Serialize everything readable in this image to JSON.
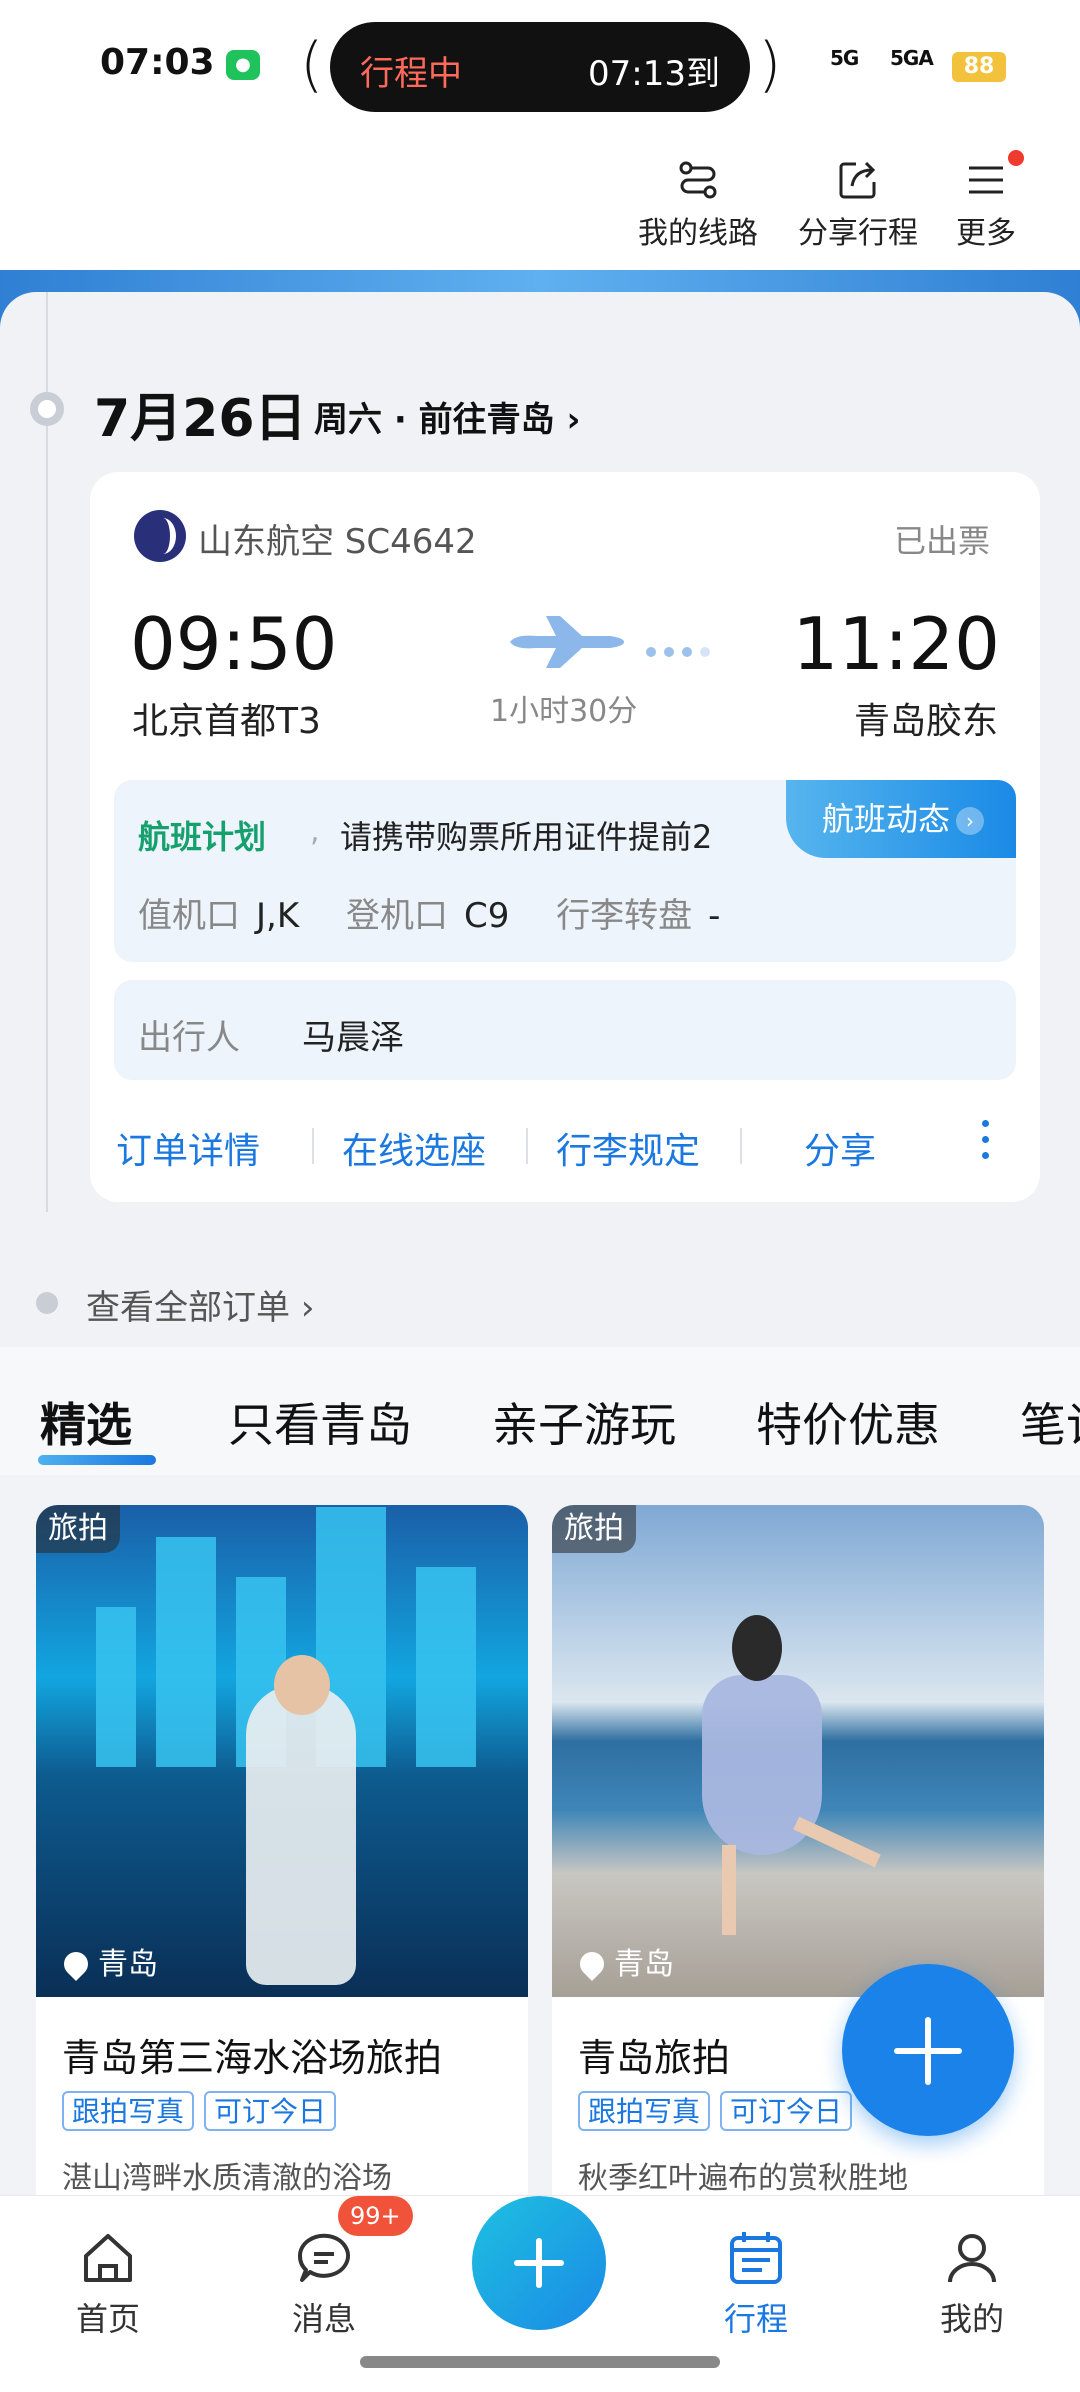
{
  "status_bar": {
    "time": "07:03",
    "island_status": "行程中",
    "island_arrival": "07:13到",
    "battery": "88",
    "signal_1": "5G",
    "signal_2": "5GA"
  },
  "top_actions": [
    {
      "label": "我的线路",
      "icon": "route-icon"
    },
    {
      "label": "分享行程",
      "icon": "share-icon"
    },
    {
      "label": "更多",
      "icon": "menu-icon"
    }
  ],
  "trip": {
    "date": "7月26日",
    "subtitle": "周六 · 前往青岛",
    "airline": "山东航空 SC4642",
    "ticket_status": "已出票",
    "departure_time": "09:50",
    "departure_airport": "北京首都T3",
    "arrival_time": "11:20",
    "arrival_airport": "青岛胶东",
    "duration": "1小时30分",
    "flight_plan_label": "航班计划",
    "flight_plan_note": "请携带购票所用证件提前2",
    "flight_status_button": "航班动态",
    "checkin_label": "值机口",
    "checkin_value": "J,K",
    "gate_label": "登机口",
    "gate_value": "C9",
    "baggage_label": "行李转盘",
    "baggage_value": "-",
    "passenger_label": "出行人",
    "passenger_name": "马晨泽",
    "actions": [
      "订单详情",
      "在线选座",
      "行李规定",
      "分享"
    ],
    "all_orders": "查看全部订单"
  },
  "tabs": [
    "精选",
    "只看青岛",
    "亲子游玩",
    "特价优惠",
    "笔记"
  ],
  "feed": [
    {
      "category": "旅拍",
      "location": "青岛",
      "title": "青岛第三海水浴场旅拍",
      "tags": [
        "跟拍写真",
        "可订今日"
      ],
      "desc": "湛山湾畔水质清澈的浴场"
    },
    {
      "category": "旅拍",
      "location": "青岛",
      "title": "青岛旅拍",
      "tags": [
        "跟拍写真",
        "可订今日"
      ],
      "desc": "秋季红叶遍布的赏秋胜地"
    }
  ],
  "bottom_nav": {
    "home": "首页",
    "messages": "消息",
    "messages_badge": "99+",
    "trips": "行程",
    "mine": "我的"
  },
  "colors": {
    "accent": "#1a78e0",
    "plan_green": "#16a06d",
    "badge_red": "#f0533a"
  }
}
